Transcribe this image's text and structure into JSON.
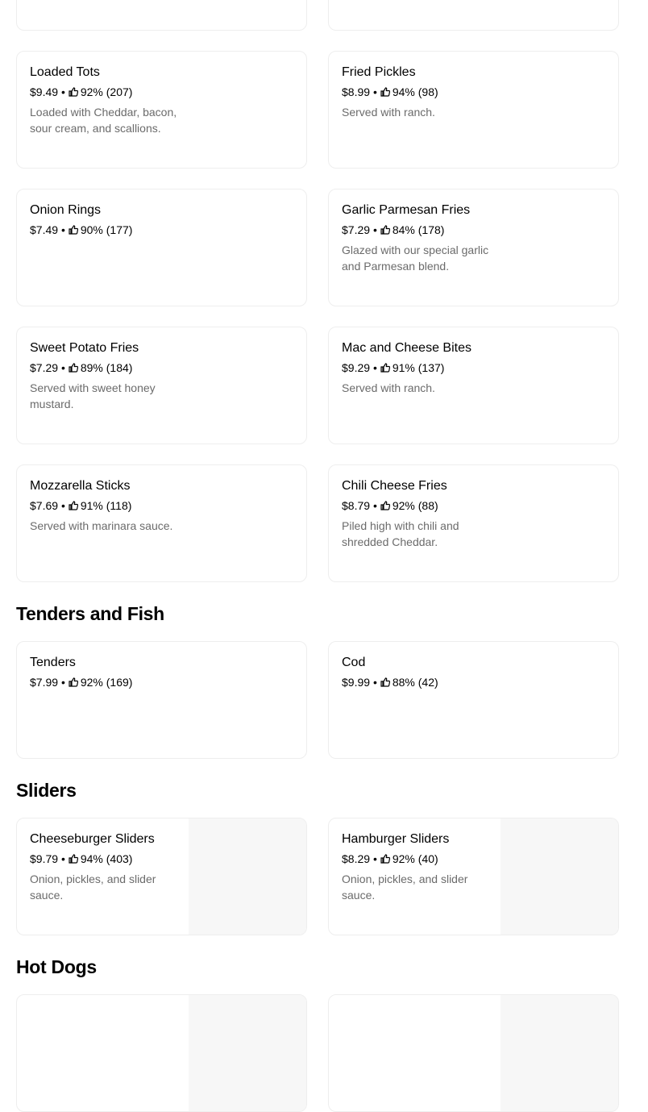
{
  "sections": [
    {
      "title": "Tenders and Fish"
    },
    {
      "title": "Sliders"
    },
    {
      "title": "Hot Dogs"
    }
  ],
  "items": [
    {
      "name": "Loaded Tots",
      "price": "$9.49",
      "rating": "92% (207)",
      "desc": "Loaded with Cheddar, bacon, sour cream, and scallions."
    },
    {
      "name": "Fried Pickles",
      "price": "$8.99",
      "rating": "94% (98)",
      "desc": "Served with ranch."
    },
    {
      "name": "Onion Rings",
      "price": "$7.49",
      "rating": "90% (177)",
      "desc": ""
    },
    {
      "name": "Garlic Parmesan Fries",
      "price": "$7.29",
      "rating": "84% (178)",
      "desc": "Glazed with our special garlic and Parmesan blend."
    },
    {
      "name": "Sweet Potato Fries",
      "price": "$7.29",
      "rating": "89% (184)",
      "desc": "Served with sweet honey mustard."
    },
    {
      "name": "Mac and Cheese Bites",
      "price": "$9.29",
      "rating": "91% (137)",
      "desc": "Served with ranch."
    },
    {
      "name": "Mozzarella Sticks",
      "price": "$7.69",
      "rating": "91% (118)",
      "desc": "Served with marinara sauce."
    },
    {
      "name": "Chili Cheese Fries",
      "price": "$8.79",
      "rating": "92% (88)",
      "desc": "Piled high with chili and shredded Cheddar."
    },
    {
      "name": "Tenders",
      "price": "$7.99",
      "rating": "92% (169)",
      "desc": ""
    },
    {
      "name": "Cod",
      "price": "$9.99",
      "rating": "88% (42)",
      "desc": ""
    },
    {
      "name": "Cheeseburger Sliders",
      "price": "$9.79",
      "rating": "94% (403)",
      "desc": "Onion, pickles, and slider sauce."
    },
    {
      "name": "Hamburger Sliders",
      "price": "$8.29",
      "rating": "92% (40)",
      "desc": "Onion, pickles, and slider sauce."
    }
  ],
  "separator": "•",
  "icons": {
    "rating": "thumbs-up-icon"
  }
}
